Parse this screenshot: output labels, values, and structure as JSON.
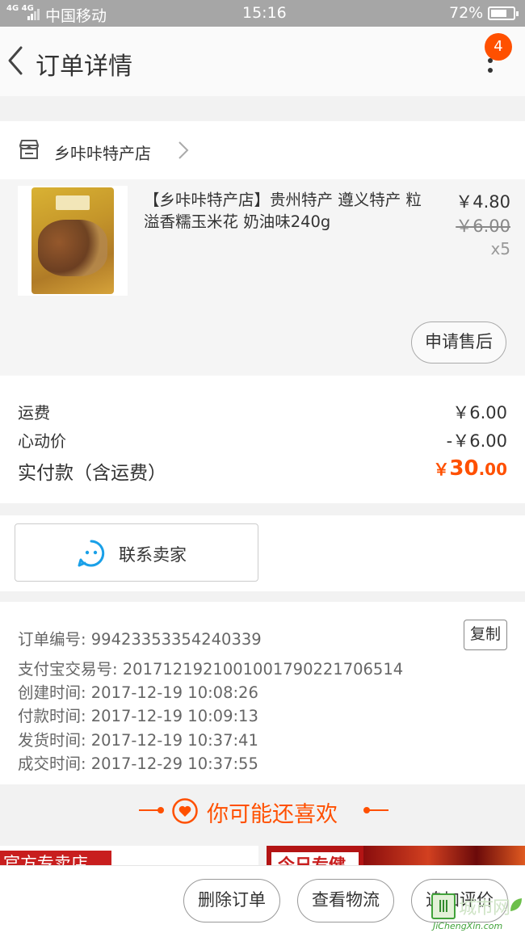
{
  "status_bar": {
    "network": "4G 4G",
    "carrier": "中国移动",
    "time": "15:16",
    "battery": "72%",
    "battery_level": 0.72
  },
  "nav": {
    "title": "订单详情",
    "badge_count": "4"
  },
  "shop": {
    "name": "乡咔咔特产店"
  },
  "item": {
    "title": "【乡咔咔特产店】贵州特产 遵义特产 粒溢香糯玉米花 奶油味240g",
    "price": "￥4.80",
    "original_price": "￥6.00",
    "quantity": "x5",
    "after_sale_label": "申请售后"
  },
  "costs": {
    "shipping_label": "运费",
    "shipping_value": "￥6.00",
    "discount_label": "心动价",
    "discount_value": "-￥6.00",
    "total_label": "实付款（含运费）",
    "total_currency": "￥",
    "total_integer": "30",
    "total_decimal": ".00"
  },
  "contact": {
    "label": "联系卖家"
  },
  "order_info": {
    "order_no": "订单编号: 99423353354240339",
    "copy_label": "复制",
    "alipay_no": "支付宝交易号: 2017121921001001790221706514",
    "created": "创建时间: 2017-12-19 10:08:26",
    "paid": "付款时间: 2017-12-19 10:09:13",
    "shipped": "发货时间: 2017-12-19 10:37:41",
    "completed": "成交时间: 2017-12-29 10:37:55"
  },
  "recommend": {
    "title": "你可能还喜欢",
    "card1_banner": "官方专卖店",
    "card2_banner": "今日专健"
  },
  "actions": {
    "delete_label": "删除订单",
    "logistics_label": "查看物流",
    "review_label": "追加评价"
  },
  "watermark": {
    "cn": "城市网",
    "en": "JiChengXin.com"
  },
  "colors": {
    "accent": "#ff5000",
    "status_bar": "#a6a6a6"
  }
}
